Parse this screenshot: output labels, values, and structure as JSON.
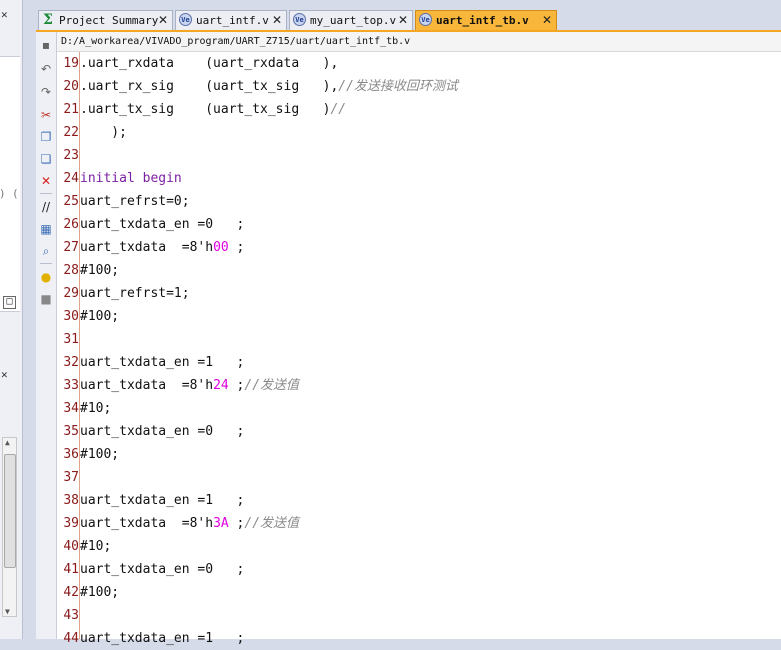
{
  "tabs": [
    {
      "label": "Project Summary",
      "icon": "sigma-icon",
      "active": false
    },
    {
      "label": "uart_intf.v",
      "icon": "verilog-file-icon",
      "active": false
    },
    {
      "label": "my_uart_top.v",
      "icon": "verilog-file-icon",
      "active": false
    },
    {
      "label": "uart_intf_tb.v",
      "icon": "verilog-file-icon",
      "active": true
    }
  ],
  "close_glyph": "✕",
  "file_path": "D:/A_workarea/VIVADO_program/UART_Z715/uart/uart_intf_tb.v",
  "toolbar_icons": [
    "save-icon",
    "undo-icon",
    "redo-icon",
    "cut-icon",
    "copy-icon",
    "paste-icon",
    "delete-icon",
    "comment-icon",
    "select-all-icon",
    "find-icon",
    "hint-bulb-icon",
    "block-icon"
  ],
  "lines": [
    {
      "n": "19",
      "parts": [
        {
          "t": ".uart_rxdata    (uart_rxdata   ),",
          "c": ""
        }
      ]
    },
    {
      "n": "20",
      "parts": [
        {
          "t": ".uart_rx_sig    (uart_tx_sig   ),",
          "c": ""
        },
        {
          "t": "//发送接收回环测试",
          "c": "cm"
        }
      ]
    },
    {
      "n": "21",
      "parts": [
        {
          "t": ".uart_tx_sig    (uart_tx_sig   )",
          "c": ""
        },
        {
          "t": "//",
          "c": "cm"
        }
      ]
    },
    {
      "n": "22",
      "parts": [
        {
          "t": "    );",
          "c": ""
        }
      ]
    },
    {
      "n": "23",
      "parts": []
    },
    {
      "n": "24",
      "parts": [
        {
          "t": "initial begin",
          "c": "kw"
        }
      ]
    },
    {
      "n": "25",
      "parts": [
        {
          "t": "uart_refrst=0;",
          "c": ""
        }
      ]
    },
    {
      "n": "26",
      "parts": [
        {
          "t": "uart_txdata_en =0   ;",
          "c": ""
        }
      ]
    },
    {
      "n": "27",
      "parts": [
        {
          "t": "uart_txdata  =8'h",
          "c": ""
        },
        {
          "t": "00",
          "c": "num"
        },
        {
          "t": " ;",
          "c": ""
        }
      ]
    },
    {
      "n": "28",
      "parts": [
        {
          "t": "#100;",
          "c": ""
        }
      ]
    },
    {
      "n": "29",
      "parts": [
        {
          "t": "uart_refrst=1;",
          "c": ""
        }
      ]
    },
    {
      "n": "30",
      "parts": [
        {
          "t": "#100;",
          "c": ""
        }
      ]
    },
    {
      "n": "31",
      "parts": []
    },
    {
      "n": "32",
      "parts": [
        {
          "t": "uart_txdata_en =1   ;",
          "c": ""
        }
      ]
    },
    {
      "n": "33",
      "parts": [
        {
          "t": "uart_txdata  =8'h",
          "c": ""
        },
        {
          "t": "24",
          "c": "num"
        },
        {
          "t": " ;",
          "c": ""
        },
        {
          "t": "//发送值",
          "c": "cm"
        }
      ]
    },
    {
      "n": "34",
      "parts": [
        {
          "t": "#10;",
          "c": ""
        }
      ]
    },
    {
      "n": "35",
      "parts": [
        {
          "t": "uart_txdata_en =0   ;",
          "c": ""
        }
      ]
    },
    {
      "n": "36",
      "parts": [
        {
          "t": "#100;",
          "c": ""
        }
      ]
    },
    {
      "n": "37",
      "parts": []
    },
    {
      "n": "38",
      "parts": [
        {
          "t": "uart_txdata_en =1   ;",
          "c": ""
        }
      ]
    },
    {
      "n": "39",
      "parts": [
        {
          "t": "uart_txdata  =8'h",
          "c": ""
        },
        {
          "t": "3A",
          "c": "num"
        },
        {
          "t": " ;",
          "c": ""
        },
        {
          "t": "//发送值",
          "c": "cm"
        }
      ]
    },
    {
      "n": "40",
      "parts": [
        {
          "t": "#10;",
          "c": ""
        }
      ]
    },
    {
      "n": "41",
      "parts": [
        {
          "t": "uart_txdata_en =0   ;",
          "c": ""
        }
      ]
    },
    {
      "n": "42",
      "parts": [
        {
          "t": "#100;",
          "c": ""
        }
      ]
    },
    {
      "n": "43",
      "parts": []
    },
    {
      "n": "44",
      "parts": [
        {
          "t": "uart_txdata_en =1   ;",
          "c": ""
        }
      ]
    }
  ],
  "colors": {
    "active_tab": "#f8b73a",
    "line_number": "#8b1a1a",
    "keyword": "#7b1fa2",
    "hex_literal": "#e000e0",
    "comment": "#8a8a8a"
  }
}
